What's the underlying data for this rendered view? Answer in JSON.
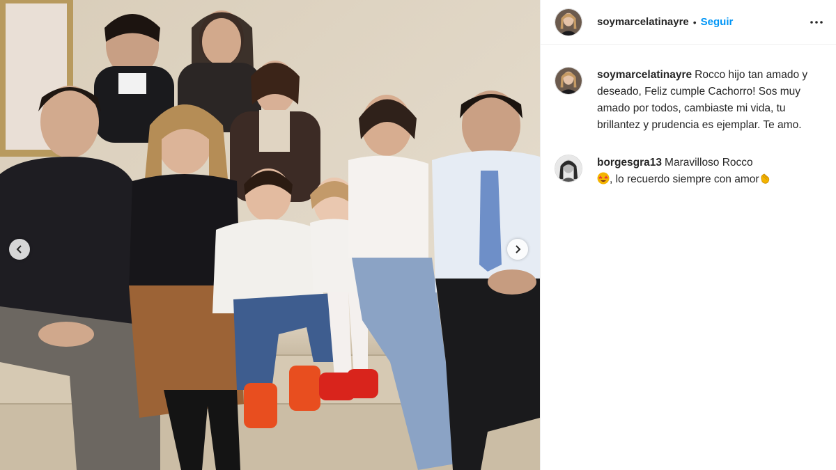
{
  "post": {
    "author": "soymarcelatinayre",
    "dot": "•",
    "follow_label": "Seguir",
    "more_icon": "more-horizontal-icon"
  },
  "comments": [
    {
      "username": "soymarcelatinayre",
      "text": "Rocco hijo tan amado y deseado, Feliz cumple Cachorro! Sos muy amado por todos, cambiaste mi vida, tu brillantez y prudencia es ejemplar. Te amo."
    },
    {
      "username": "borgesgra13",
      "text_before": "Maravilloso Rocco",
      "emoji1": "star-struck-emoji",
      "text_middle": ", lo recuerdo siempre con amor",
      "emoji2": "clapping-hands-emoji"
    }
  ],
  "carousel": {
    "prev_icon": "chevron-left-icon",
    "next_icon": "chevron-right-icon"
  },
  "colors": {
    "accent": "#0095f6",
    "text": "#262626",
    "divider": "#efefef"
  }
}
